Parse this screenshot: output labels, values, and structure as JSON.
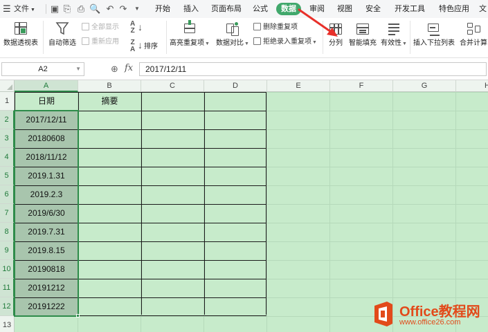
{
  "menubar": {
    "file_label": "文件",
    "tabs": [
      "开始",
      "插入",
      "页面布局",
      "公式",
      "数据",
      "审阅",
      "视图",
      "安全",
      "开发工具",
      "特色应用",
      "文"
    ],
    "active_tab": "数据"
  },
  "ribbon": {
    "pivot_table": "数据透视表",
    "auto_filter": "自动筛选",
    "show_all": "全部显示",
    "reapply": "重新应用",
    "sort": "排序",
    "highlight_duplicates": "高亮重复项",
    "data_compare": "数据对比",
    "delete_duplicates": "删除重复项",
    "reject_duplicates": "拒绝录入重复项",
    "split_column": "分列",
    "smart_fill": "智能填充",
    "validation": "有效性",
    "insert_dropdown": "插入下拉列表",
    "consolidate": "合并计算"
  },
  "formula_bar": {
    "name_box": "A2",
    "fx_label": "fx",
    "formula_value": "2017/12/11"
  },
  "sheet": {
    "columns": [
      "A",
      "B",
      "C",
      "D",
      "E",
      "F",
      "G",
      "H"
    ],
    "rows": [
      "1",
      "2",
      "3",
      "4",
      "5",
      "6",
      "7",
      "8",
      "9",
      "10",
      "11",
      "12",
      "13"
    ],
    "header_row": {
      "A1": "日期",
      "B1": "摘要"
    },
    "dates": [
      "2017/12/11",
      "20180608",
      "2018/11/12",
      "2019.1.31",
      "2019.2.3",
      "2019/6/30",
      "2019.7.31",
      "2019.8.15",
      "20190818",
      "20191212",
      "20191222"
    ]
  },
  "watermark": {
    "brand": "Office教程网",
    "url": "www.office26.com"
  },
  "colors": {
    "sheet_bg": "#c7ebcb",
    "active_tab": "#41a86c",
    "selection": "#2e8b4a",
    "arrow": "#e8302a"
  }
}
